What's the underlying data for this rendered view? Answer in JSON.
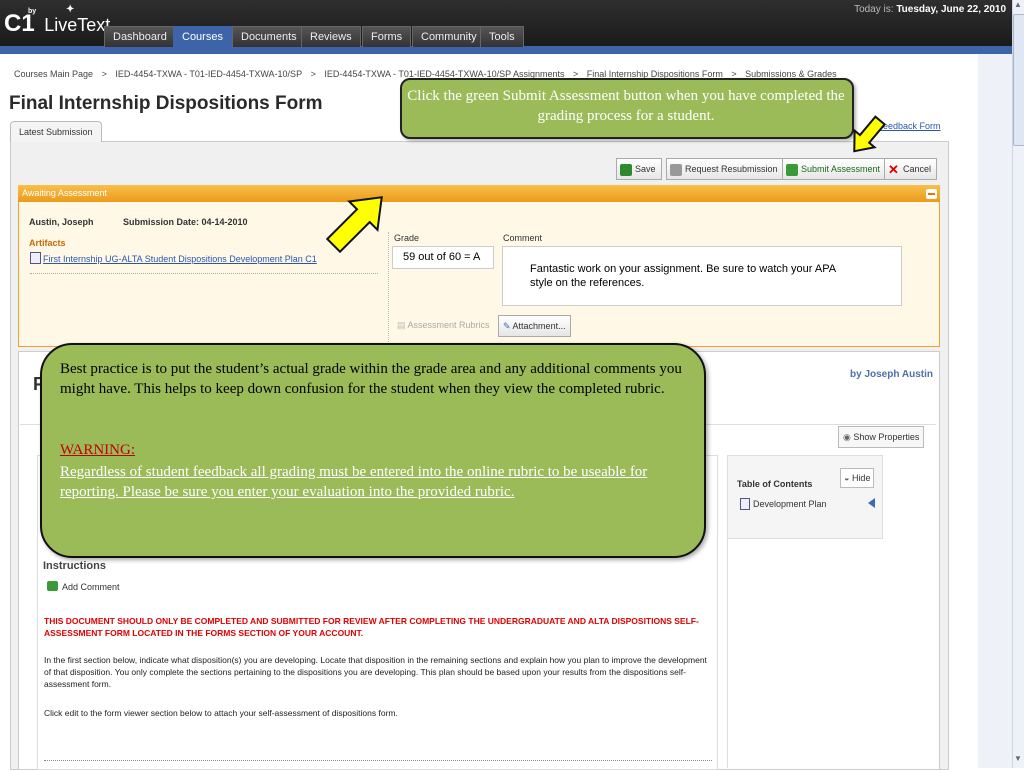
{
  "app": {
    "logo_c1": "C1",
    "logo_by": "by",
    "logo_name": "LiveText",
    "today_prefix": "Today is:",
    "today_date": "Tuesday, June 22, 2010"
  },
  "nav": {
    "tabs": [
      {
        "label": "Dashboard"
      },
      {
        "label": "Courses",
        "active": true
      },
      {
        "label": "Documents"
      },
      {
        "label": "Reviews"
      },
      {
        "label": "Forms"
      },
      {
        "label": "Community"
      },
      {
        "label": "Tools"
      }
    ]
  },
  "breadcrumb": {
    "items": [
      "Courses Main Page",
      ">",
      "IED-4454-TXWA - T01-IED-4454-TXWA-10/SP",
      ">",
      "IED-4454-TXWA - T01-IED-4454-TXWA-10/SP Assignments",
      ">",
      "Final Internship Dispositions Form",
      ">",
      "Submissions & Grades"
    ]
  },
  "page": {
    "title": "Final Internship Dispositions Form",
    "tab_latest": "Latest Submission",
    "feedback_link": "e Feedback Form"
  },
  "toolbar": {
    "save": "Save",
    "request_resubmission": "Request Resubmission",
    "submit_assessment": "Submit Assessment",
    "cancel": "Cancel"
  },
  "assessment": {
    "header": "Awaiting Assessment",
    "student": "Austin, Joseph",
    "submission_date": "Submission Date: 04-14-2010",
    "artifacts_label": "Artifacts",
    "artifact_link": "First Internship UG-ALTA Student Dispositions Development Plan C1",
    "grade_label": "Grade",
    "grade_value": "59 out of 60 = A",
    "comment_label": "Comment",
    "comment_value": "Fantastic work on your assignment.  Be sure to watch your APA style on the references.",
    "rubrics_button": "Assessment Rubrics",
    "attachment_button": "Attachment..."
  },
  "document": {
    "author": "by Joseph Austin",
    "show_properties": "Show Properties",
    "toc_title": "Table of Contents",
    "toc_hide": "Hide",
    "toc_item": "Development Plan",
    "instructions_heading": "Instructions",
    "add_comment": "Add Comment",
    "warning_text": "THIS DOCUMENT SHOULD ONLY BE COMPLETED AND SUBMITTED FOR REVIEW AFTER COMPLETING THE UNDERGRADUATE AND ALTA DISPOSITIONS SELF-ASSESSMENT FORM LOCATED IN THE FORMS SECTION OF YOUR ACCOUNT.",
    "paragraph1": "In the first section below, indicate what disposition(s) you are developing.  Locate that disposition in the remaining sections and explain how you plan to improve the development of that disposition.  You only complete the sections pertaining to the dispositions you are developing.  This plan should be based upon your results from the dispositions self-assessment form.",
    "paragraph2": "Click edit to the form viewer section below to attach your self-assessment of dispositions form."
  },
  "callouts": {
    "top": "Click the green Submit Assessment button when you have completed the grading process for a student.",
    "main_body": "Best practice is to put the student’s actual grade within the grade area and any additional comments you might have.  This helps to keep down confusion for the student when they view the completed rubric.",
    "warning_title": "WARNING:",
    "warning_body": "Regardless of student feedback all grading must be entered into the online rubric to be useable for reporting.  Please be sure you enter your evaluation into the provided rubric."
  },
  "colors": {
    "callout_green": "#9bbb59",
    "arrow_yellow": "#ffff00",
    "await_orange": "#eb9a1a",
    "nav_blue": "#3d64a8"
  }
}
